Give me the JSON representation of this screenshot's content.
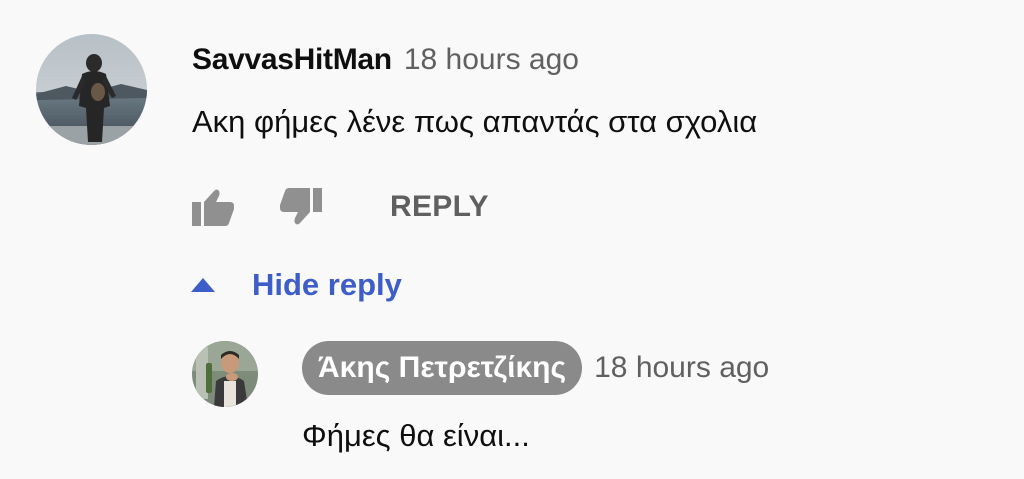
{
  "comment": {
    "author": "SavvasHitMan",
    "timestamp": "18 hours ago",
    "text": "Ακη φήμες λένε πως απαντάς στα σχολια",
    "avatar_icon": "diver-photo-avatar",
    "actions": {
      "like_icon": "thumbs-up-icon",
      "dislike_icon": "thumbs-down-icon",
      "reply_label": "REPLY"
    },
    "hide_replies_label": "Hide reply",
    "hide_replies_icon": "caret-up-icon"
  },
  "reply": {
    "author": "Άκης Πετρετζίκης",
    "timestamp": "18 hours ago",
    "text": "Φήμες θα είναι...",
    "avatar_icon": "creator-photo-avatar",
    "author_badge_color": "#8a8a8a"
  },
  "colors": {
    "background": "#f9f9f9",
    "link_blue": "#3d5dc9",
    "secondary_text": "#606060",
    "icon_gray": "#909090"
  }
}
